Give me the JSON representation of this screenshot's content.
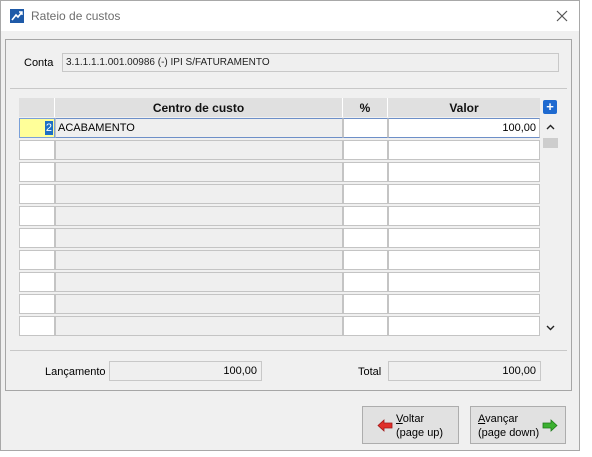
{
  "window": {
    "title": "Rateio de custos",
    "close_glyph": "✕"
  },
  "conta": {
    "label": "Conta",
    "value": "3.1.1.1.1.001.00986 (-) IPI S/FATURAMENTO"
  },
  "grid": {
    "columns": [
      "Centro de custo",
      "%",
      "Valor"
    ],
    "add_glyph": "+",
    "rows": [
      {
        "code": "2",
        "name": "ACABAMENTO",
        "pct": "",
        "value": "100,00"
      },
      {
        "code": "",
        "name": "",
        "pct": "",
        "value": ""
      },
      {
        "code": "",
        "name": "",
        "pct": "",
        "value": ""
      },
      {
        "code": "",
        "name": "",
        "pct": "",
        "value": ""
      },
      {
        "code": "",
        "name": "",
        "pct": "",
        "value": ""
      },
      {
        "code": "",
        "name": "",
        "pct": "",
        "value": ""
      },
      {
        "code": "",
        "name": "",
        "pct": "",
        "value": ""
      },
      {
        "code": "",
        "name": "",
        "pct": "",
        "value": ""
      },
      {
        "code": "",
        "name": "",
        "pct": "",
        "value": ""
      },
      {
        "code": "",
        "name": "",
        "pct": "",
        "value": ""
      }
    ]
  },
  "footer": {
    "lancamento_label": "Lançamento",
    "lancamento_value": "100,00",
    "total_label": "Total",
    "total_value": "100,00"
  },
  "buttons": {
    "back": {
      "accel": "V",
      "rest": "oltar",
      "line2": "(page up)"
    },
    "next": {
      "accel": "A",
      "rest": "vançar",
      "line2": "(page down)"
    }
  },
  "colors": {
    "selected_code_bg": "#ffff99",
    "selected_code_highlight": "#1e6fc4",
    "add_button": "#1f6ad0",
    "back_arrow": "#e0302a",
    "next_arrow": "#3bb030"
  }
}
